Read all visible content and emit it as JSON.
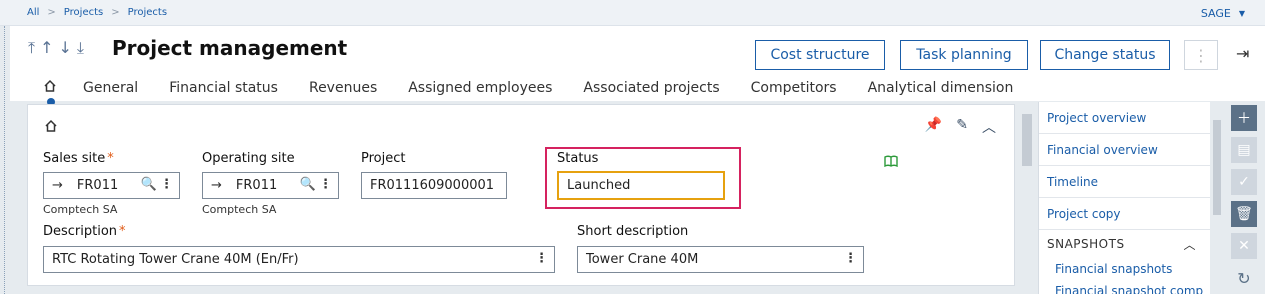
{
  "breadcrumb": {
    "items": [
      "All",
      "Projects",
      "Projects"
    ]
  },
  "user": {
    "name": "SAGE"
  },
  "header": {
    "title": "Project management",
    "buttons": {
      "cost_structure": "Cost structure",
      "task_planning": "Task planning",
      "change_status": "Change status"
    }
  },
  "tabs": [
    "General",
    "Financial status",
    "Revenues",
    "Assigned employees",
    "Associated projects",
    "Competitors",
    "Analytical dimension"
  ],
  "form": {
    "sales_site": {
      "label": "Sales site",
      "value": "FR011",
      "description": "Comptech SA"
    },
    "operating_site": {
      "label": "Operating site",
      "value": "FR011",
      "description": "Comptech SA"
    },
    "project": {
      "label": "Project",
      "value": "FR0111609000001"
    },
    "status": {
      "label": "Status",
      "value": "Launched"
    },
    "description": {
      "label": "Description",
      "value": "RTC Rotating Tower Crane 40M (En/Fr)"
    },
    "short_description": {
      "label": "Short description",
      "value": "Tower Crane 40M"
    },
    "required_mark": "*"
  },
  "sidebar": {
    "items": [
      "Project overview",
      "Financial overview",
      "Timeline",
      "Project copy"
    ],
    "section": "SNAPSHOTS",
    "section_items": [
      "Financial snapshots",
      "Financial snapshot comp"
    ]
  },
  "colors": {
    "accent": "#1a5da8",
    "highlight_frame": "#d5225f",
    "focus_border": "#e6a10f",
    "required": "#e05a16"
  }
}
